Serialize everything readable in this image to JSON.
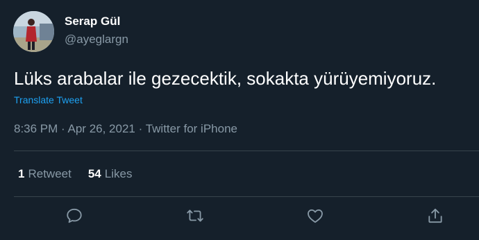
{
  "author": {
    "name": "Serap Gül",
    "handle": "@ayeglargn"
  },
  "tweet": {
    "text": "Lüks arabalar ile gezecektik, sokakta yürüyemiyoruz.",
    "translate_label": "Translate Tweet",
    "time": "8:36 PM",
    "date": "Apr 26, 2021",
    "source": "Twitter for iPhone",
    "separator": "·"
  },
  "stats": {
    "retweets_count": "1",
    "retweets_label": "Retweet",
    "likes_count": "54",
    "likes_label": "Likes"
  },
  "actions": {
    "reply_icon": "reply-icon",
    "retweet_icon": "retweet-icon",
    "like_icon": "like-icon",
    "share_icon": "share-icon"
  },
  "colors": {
    "background": "#15202b",
    "text_primary": "#ffffff",
    "text_secondary": "#8899a6",
    "link": "#1da1f2",
    "divider": "#38444d"
  }
}
